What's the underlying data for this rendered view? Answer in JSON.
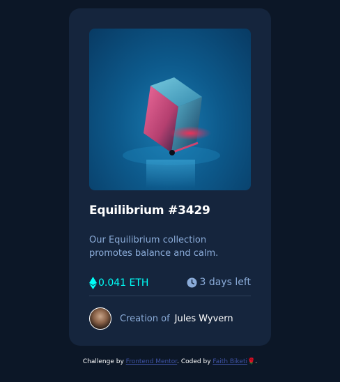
{
  "card": {
    "title": "Equilibrium #3429",
    "description": "Our Equilibrium collection promotes balance and calm.",
    "price": "0.041 ETH",
    "time_left": "3 days left",
    "creation_prefix": "Creation of",
    "creator_name": "Jules Wyvern",
    "image_alt": "equilibrium-cube-image",
    "icons": {
      "price": "ethereum-icon",
      "time": "clock-icon"
    }
  },
  "attribution": {
    "challenge_prefix": "Challenge by",
    "challenge_link": "Frontend Mentor",
    "coded_prefix": ". Coded by",
    "coder_link": "Faith Biketi",
    "suffix_emoji": "🌹",
    "end": "."
  },
  "colors": {
    "page_bg": "#0c1727",
    "card_bg": "#15253d",
    "cyan": "#00fff8",
    "soft_blue": "#8bacd9",
    "white": "#ffffff"
  }
}
